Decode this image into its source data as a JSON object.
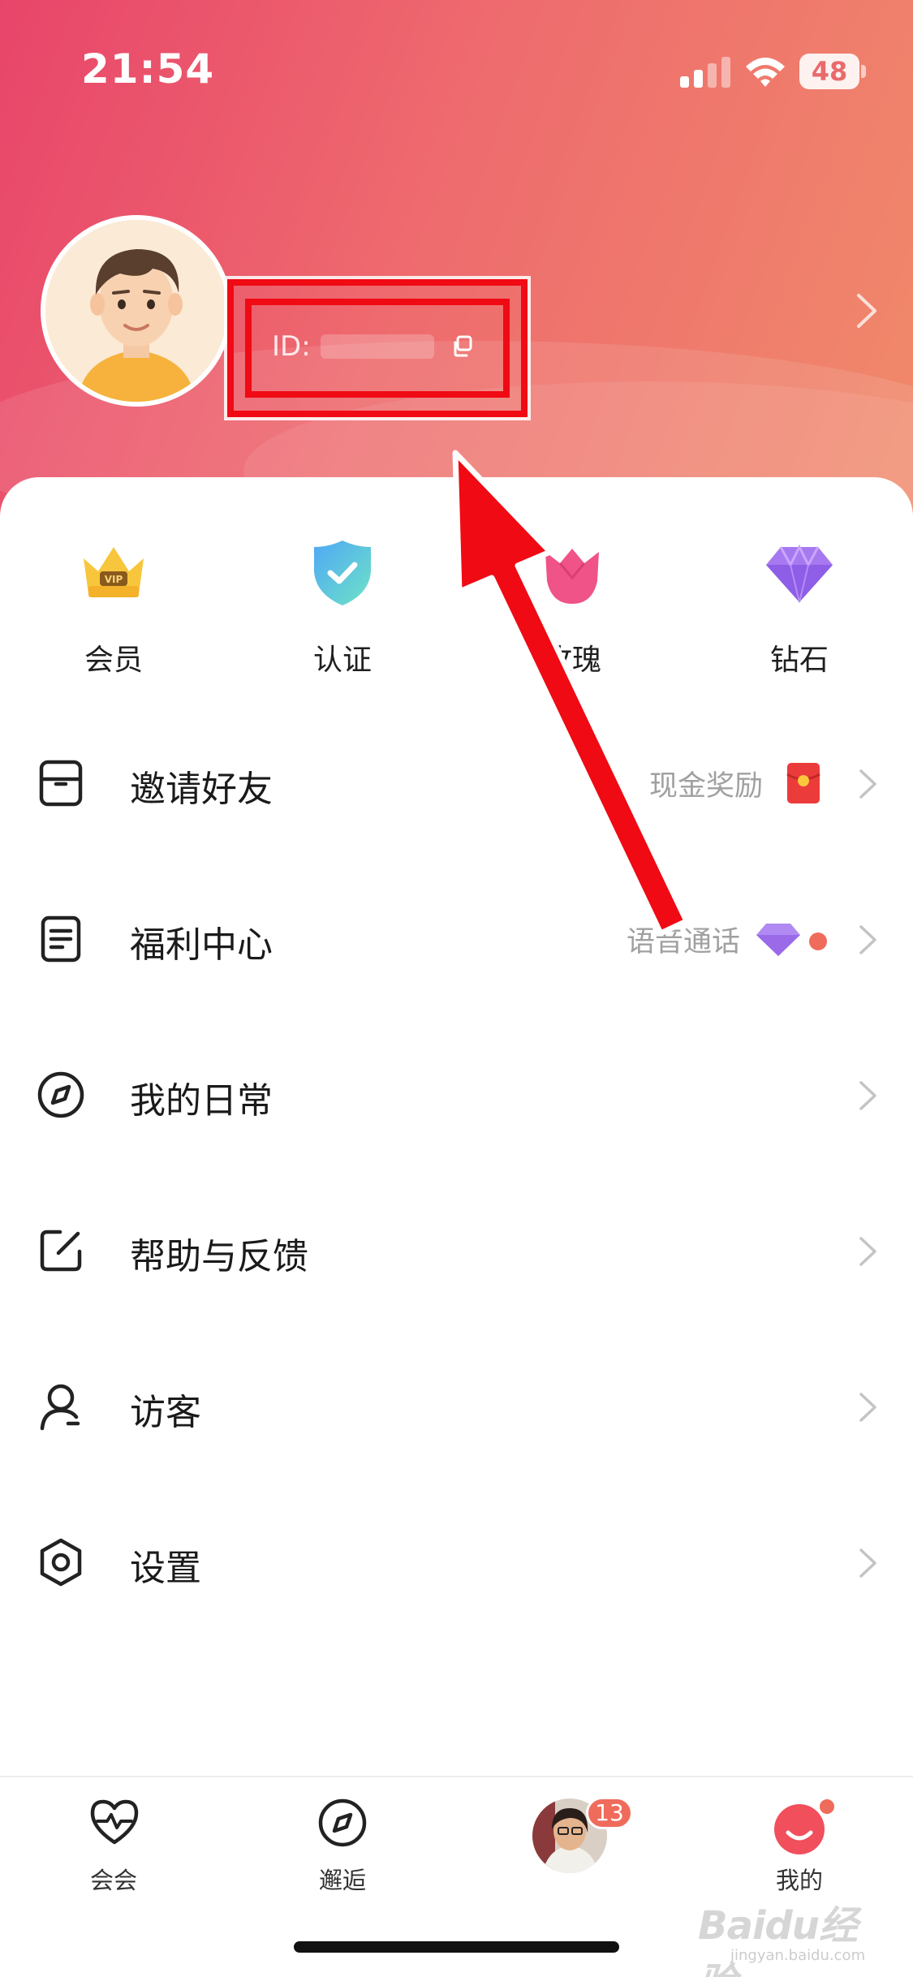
{
  "status_bar": {
    "time": "21:54",
    "battery": "48"
  },
  "profile": {
    "id_label": "ID:"
  },
  "quick_actions": [
    {
      "label": "会员",
      "icon": "vip-crown-icon"
    },
    {
      "label": "认证",
      "icon": "verified-shield-icon"
    },
    {
      "label": "玫瑰",
      "icon": "rose-icon"
    },
    {
      "label": "钻石",
      "icon": "diamond-icon"
    }
  ],
  "menu": {
    "invite": {
      "label": "邀请好友",
      "extra": "现金奖励",
      "icon": "invite-icon"
    },
    "welfare": {
      "label": "福利中心",
      "extra": "语音通话",
      "icon": "document-icon"
    },
    "daily": {
      "label": "我的日常",
      "icon": "compass-icon"
    },
    "help": {
      "label": "帮助与反馈",
      "icon": "edit-icon"
    },
    "visitors": {
      "label": "访客",
      "icon": "person-icon"
    },
    "settings": {
      "label": "设置",
      "icon": "hexagon-gear-icon"
    }
  },
  "tabs": [
    {
      "label": "会会",
      "icon": "heart-pulse-icon"
    },
    {
      "label": "邂逅",
      "icon": "compass-icon"
    },
    {
      "label": "",
      "badge": "13",
      "icon": "chat-avatar-icon"
    },
    {
      "label": "我的",
      "icon": "smile-face-icon"
    }
  ],
  "watermark": {
    "text": "Baidu经验",
    "sub": "jingyan.baidu.com"
  },
  "colors": {
    "accent": "#e8456a",
    "annotation": "#f00a14",
    "badge": "#ef6b5b"
  }
}
